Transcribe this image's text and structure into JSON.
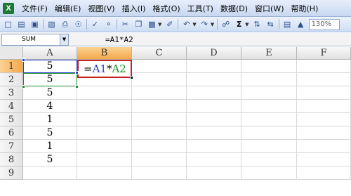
{
  "menu": {
    "items": [
      "文件(F)",
      "编辑(E)",
      "视图(V)",
      "插入(I)",
      "格式(O)",
      "工具(T)",
      "数据(D)",
      "窗口(W)",
      "帮助(H)"
    ]
  },
  "toolbar": {
    "sum_symbol": "Σ",
    "zoom": "130%"
  },
  "formula_bar": {
    "name_box": "SUM",
    "formula": "=A1*A2"
  },
  "sheet": {
    "columns": [
      "A",
      "B",
      "C",
      "D",
      "E",
      "F"
    ],
    "rows": [
      "1",
      "2",
      "3",
      "4",
      "5",
      "6",
      "7",
      "8",
      "9"
    ],
    "column_a_values": [
      "5",
      "5",
      "5",
      "4",
      "1",
      "5",
      "1",
      "5",
      ""
    ],
    "active_cell": "B1",
    "editing_text": {
      "eq": "=",
      "ref1": "A1",
      "op": "*",
      "ref2": "A2"
    }
  }
}
